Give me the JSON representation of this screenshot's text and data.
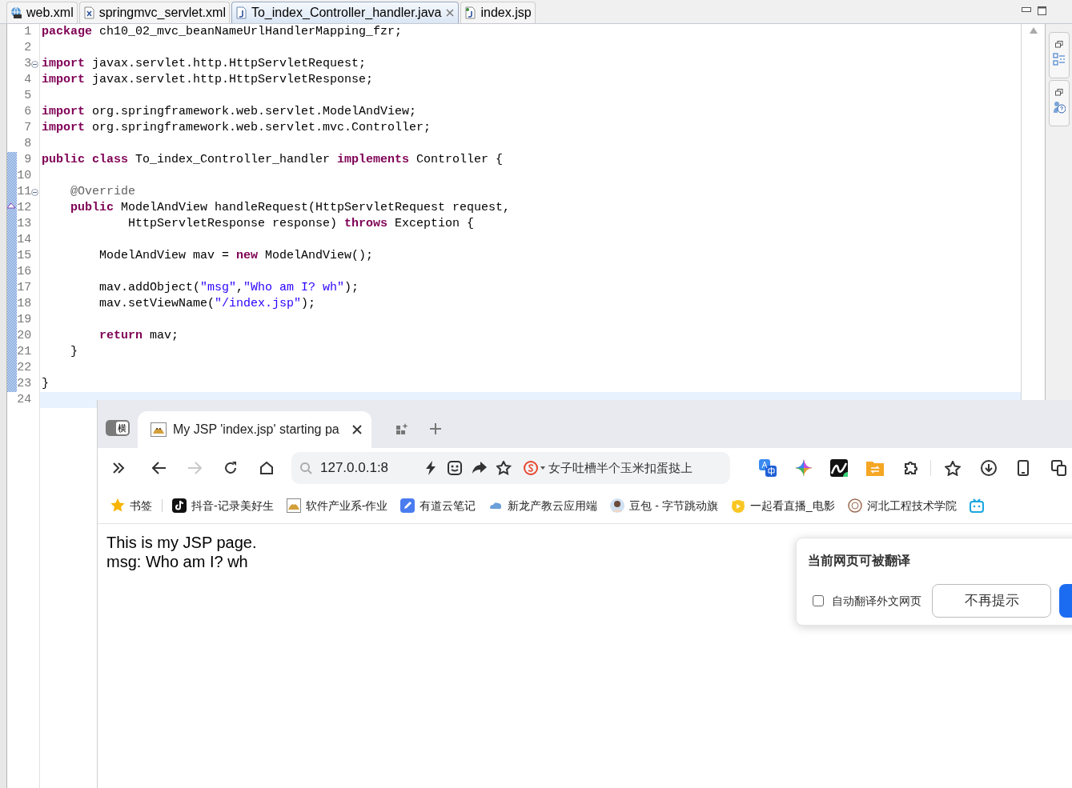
{
  "editor_tabs": [
    {
      "label": "web.xml",
      "kind": "web-xml",
      "selected": false
    },
    {
      "label": "springmvc_servlet.xml",
      "kind": "xml",
      "selected": false
    },
    {
      "label": "To_index_Controller_handler.java",
      "kind": "java",
      "selected": true
    },
    {
      "label": "index.jsp",
      "kind": "jsp",
      "selected": false
    }
  ],
  "code": {
    "lines": [
      {
        "number": "1",
        "current": false,
        "changed": false,
        "fold": false,
        "override": false,
        "tokens": [
          {
            "kind": "kw",
            "text": "package"
          },
          {
            "kind": "plain",
            "text": " ch10_02_mvc_beanNameUrlHandlerMapping_fzr;"
          }
        ]
      },
      {
        "number": "2",
        "current": false,
        "changed": false,
        "fold": false,
        "override": false
      },
      {
        "number": "3",
        "current": false,
        "changed": false,
        "fold": true,
        "override": false,
        "tokens": [
          {
            "kind": "kw",
            "text": "import"
          },
          {
            "kind": "plain",
            "text": " javax.servlet.http.HttpServletRequest;"
          }
        ]
      },
      {
        "number": "4",
        "current": false,
        "changed": false,
        "fold": false,
        "override": false,
        "tokens": [
          {
            "kind": "kw",
            "text": "import"
          },
          {
            "kind": "plain",
            "text": " javax.servlet.http.HttpServletResponse;"
          }
        ]
      },
      {
        "number": "5",
        "current": false,
        "changed": false,
        "fold": false,
        "override": false
      },
      {
        "number": "6",
        "current": false,
        "changed": false,
        "fold": false,
        "override": false,
        "tokens": [
          {
            "kind": "kw",
            "text": "import"
          },
          {
            "kind": "plain",
            "text": " org.springframework.web.servlet.ModelAndView;"
          }
        ]
      },
      {
        "number": "7",
        "current": false,
        "changed": false,
        "fold": false,
        "override": false,
        "tokens": [
          {
            "kind": "kw",
            "text": "import"
          },
          {
            "kind": "plain",
            "text": " org.springframework.web.servlet.mvc.Controller;"
          }
        ]
      },
      {
        "number": "8",
        "current": false,
        "changed": false,
        "fold": false,
        "override": false
      },
      {
        "number": "9",
        "current": false,
        "changed": true,
        "fold": false,
        "override": false,
        "tokens": [
          {
            "kind": "kw",
            "text": "public class"
          },
          {
            "kind": "plain",
            "text": " To_index_Controller_handler "
          },
          {
            "kind": "kw",
            "text": "implements"
          },
          {
            "kind": "plain",
            "text": " Controller {"
          }
        ]
      },
      {
        "number": "10",
        "current": false,
        "changed": true,
        "fold": false,
        "override": false
      },
      {
        "number": "11",
        "current": false,
        "changed": true,
        "fold": true,
        "override": false,
        "tokens": [
          {
            "kind": "ann",
            "text": "    @Override"
          }
        ]
      },
      {
        "number": "12",
        "current": false,
        "changed": true,
        "fold": false,
        "override": true,
        "tokens": [
          {
            "kind": "kw",
            "text": "    public"
          },
          {
            "kind": "plain",
            "text": " ModelAndView handleRequest(HttpServletRequest request,"
          }
        ]
      },
      {
        "number": "13",
        "current": false,
        "changed": true,
        "fold": false,
        "override": false,
        "tokens": [
          {
            "kind": "plain",
            "text": "            HttpServletResponse response) "
          },
          {
            "kind": "kw",
            "text": "throws"
          },
          {
            "kind": "plain",
            "text": " Exception {"
          }
        ]
      },
      {
        "number": "14",
        "current": false,
        "changed": true,
        "fold": false,
        "override": false
      },
      {
        "number": "15",
        "current": false,
        "changed": true,
        "fold": false,
        "override": false,
        "tokens": [
          {
            "kind": "plain",
            "text": "        ModelAndView mav = "
          },
          {
            "kind": "kw",
            "text": "new"
          },
          {
            "kind": "plain",
            "text": " ModelAndView();"
          }
        ]
      },
      {
        "number": "16",
        "current": false,
        "changed": true,
        "fold": false,
        "override": false
      },
      {
        "number": "17",
        "current": false,
        "changed": true,
        "fold": false,
        "override": false,
        "tokens": [
          {
            "kind": "plain",
            "text": "        mav.addObject("
          },
          {
            "kind": "str",
            "text": "\"msg\""
          },
          {
            "kind": "plain",
            "text": ","
          },
          {
            "kind": "str",
            "text": "\"Who am I? wh\""
          },
          {
            "kind": "plain",
            "text": ");"
          }
        ]
      },
      {
        "number": "18",
        "current": false,
        "changed": true,
        "fold": false,
        "override": false,
        "tokens": [
          {
            "kind": "plain",
            "text": "        mav.setViewName("
          },
          {
            "kind": "str",
            "text": "\"/index.jsp\""
          },
          {
            "kind": "plain",
            "text": ");"
          }
        ]
      },
      {
        "number": "19",
        "current": false,
        "changed": true,
        "fold": false,
        "override": false
      },
      {
        "number": "20",
        "current": false,
        "changed": true,
        "fold": false,
        "override": false,
        "tokens": [
          {
            "kind": "kw",
            "text": "        return"
          },
          {
            "kind": "plain",
            "text": " mav;"
          }
        ]
      },
      {
        "number": "21",
        "current": false,
        "changed": true,
        "fold": false,
        "override": false,
        "tokens": [
          {
            "kind": "plain",
            "text": "    }"
          }
        ]
      },
      {
        "number": "22",
        "current": false,
        "changed": true,
        "fold": false,
        "override": false
      },
      {
        "number": "23",
        "current": false,
        "changed": true,
        "fold": false,
        "override": false,
        "tokens": [
          {
            "kind": "plain",
            "text": "}"
          }
        ]
      },
      {
        "number": "24",
        "current": true,
        "changed": false,
        "fold": false,
        "override": false
      }
    ]
  },
  "browser": {
    "side_toggle": "横",
    "tab": {
      "title": "My JSP 'index.jsp' starting pa",
      "selected": true
    },
    "address": "127.0.0.1:8",
    "suggestion": "女子吐槽半个玉米扣蛋挞上",
    "bookmarks": [
      {
        "label": "书签",
        "kind": "star"
      },
      {
        "label": "抖音-记录美好生",
        "kind": "tiktok"
      },
      {
        "label": "软件产业系-作业",
        "kind": "tomcat"
      },
      {
        "label": "有道云笔记",
        "kind": "note"
      },
      {
        "label": "新龙产教云应用端",
        "kind": "cloud"
      },
      {
        "label": "豆包 - 字节跳动旗",
        "kind": "avatar"
      },
      {
        "label": "一起看直播_电影",
        "kind": "tiger"
      },
      {
        "label": "河北工程技术学院",
        "kind": "seal"
      }
    ],
    "page_lines": [
      "This is my JSP page.",
      "msg: Who am I? wh"
    ],
    "translate_popup": {
      "title": "当前网页可被翻译",
      "auto_translate": {
        "label": "自动翻译外文网页",
        "checked": false
      },
      "dismiss_button": "不再提示"
    }
  }
}
